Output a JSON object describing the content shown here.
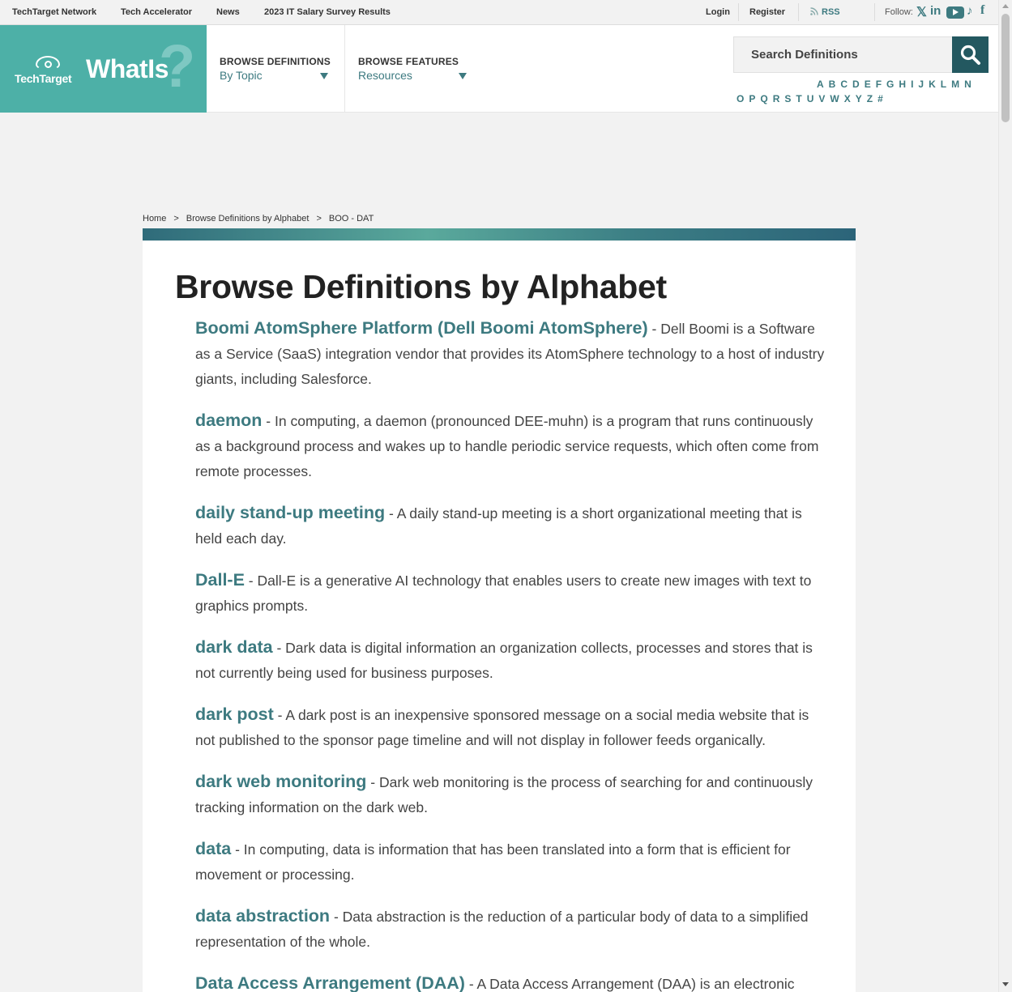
{
  "topbar": {
    "network": "TechTarget Network",
    "accelerator": "Tech Accelerator",
    "news": "News",
    "salary": "2023 IT Salary Survey Results",
    "login": "Login",
    "register": "Register",
    "rss": "RSS",
    "follow": "Follow:"
  },
  "social": {
    "x": "𝕏",
    "linkedin": "in",
    "tiktok": "♪",
    "facebook": "f"
  },
  "brand": {
    "techtarget": "TechTarget",
    "whatis": "WhatIs",
    "qmark": "?"
  },
  "nav": {
    "definitions_label": "BROWSE DEFINITIONS",
    "definitions_value": "By Topic",
    "features_label": "BROWSE FEATURES",
    "features_value": "Resources"
  },
  "search": {
    "placeholder": "Search Definitions"
  },
  "alphabet": {
    "row1": [
      "A",
      "B",
      "C",
      "D",
      "E",
      "F",
      "G",
      "H",
      "I",
      "J",
      "K",
      "L",
      "M",
      "N"
    ],
    "row2": [
      "O",
      "P",
      "Q",
      "R",
      "S",
      "T",
      "U",
      "V",
      "W",
      "X",
      "Y",
      "Z",
      "#"
    ]
  },
  "breadcrumb": {
    "home": "Home",
    "alphabet": "Browse Definitions by Alphabet",
    "current": "BOO - DAT",
    "sep": ">"
  },
  "page": {
    "title": "Browse Definitions by Alphabet"
  },
  "entries": [
    {
      "term": "Boomi AtomSphere Platform (Dell Boomi AtomSphere)",
      "desc": "Dell Boomi is a Software as a Service (SaaS) integration vendor that provides its AtomSphere technology to a host of industry giants, including Salesforce."
    },
    {
      "term": "daemon",
      "desc": "In computing, a daemon (pronounced DEE-muhn) is a program that runs continuously as a background process and wakes up to handle periodic service requests, which often come from remote processes."
    },
    {
      "term": "daily stand-up meeting",
      "desc": "A daily stand-up meeting is a short organizational meeting that is held each day."
    },
    {
      "term": "Dall-E",
      "desc": "Dall-E is a generative AI technology that enables users to create new images with text to graphics prompts."
    },
    {
      "term": "dark data",
      "desc": "Dark data is digital information an organization collects, processes and stores that is not currently being used for business purposes."
    },
    {
      "term": "dark post",
      "desc": "A dark post is an inexpensive sponsored message on a social media website that is not published to the sponsor page timeline and will not display in follower feeds organically."
    },
    {
      "term": "dark web monitoring",
      "desc": "Dark web monitoring is the process of searching for and continuously tracking information on the dark web."
    },
    {
      "term": "data",
      "desc": "In computing, data is information that has been translated into a form that is efficient for movement or processing."
    },
    {
      "term": "data abstraction",
      "desc": "Data abstraction is the reduction of a particular body of data to a simplified representation of the whole."
    },
    {
      "term": "Data Access Arrangement (DAA)",
      "desc": "A Data Access Arrangement (DAA) is an electronic interface within a computer and its modem to a public telephone line."
    }
  ],
  "colors": {
    "brand_teal": "#4db0a7",
    "link_teal": "#3d7a80",
    "search_button": "#235860"
  },
  "icons": [
    "rss-icon",
    "x-icon",
    "linkedin-icon",
    "youtube-icon",
    "tiktok-icon",
    "facebook-icon",
    "search-icon",
    "chevron-down-icon"
  ]
}
